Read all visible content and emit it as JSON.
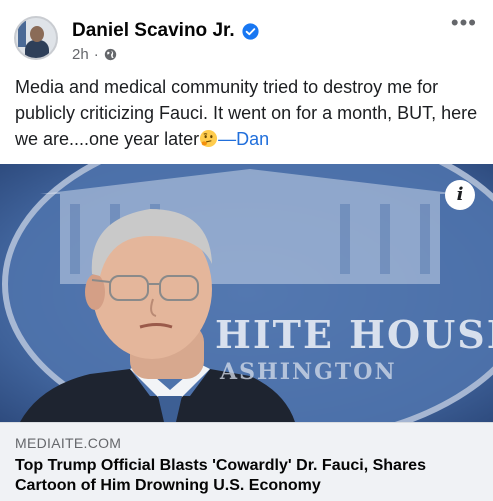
{
  "post": {
    "author": "Daniel Scavino Jr.",
    "time": "2h",
    "separator": "·",
    "more_label": "•••",
    "text_main": "Media and medical community tried to destroy me for publicly criticizing Fauci. It went on for a month, BUT, here we are....one year later",
    "emoji": "thinking-face-emoji",
    "signature": "—Dan",
    "icons": {
      "verified": "verified-badge-icon",
      "privacy": "globe-icon",
      "info": "info-icon"
    }
  },
  "photo": {
    "backdrop_text_1": "HITE HOUSE",
    "backdrop_text_2": "ASHINGTON",
    "info_label": "i"
  },
  "link": {
    "domain": "MEDIAITE.COM",
    "title": "Top Trump Official Blasts 'Cowardly' Dr. Fauci, Shares Cartoon of Him Drowning U.S. Economy"
  },
  "colors": {
    "verified_blue": "#1877f2",
    "signature_blue": "#216fdb",
    "link_box_bg": "#f0f2f5"
  }
}
